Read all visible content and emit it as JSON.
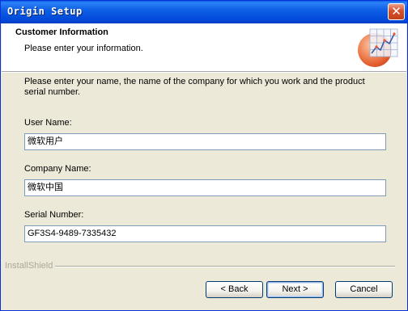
{
  "window": {
    "title": "Origin Setup",
    "close_glyph": "✕"
  },
  "header": {
    "title": "Customer Information",
    "subtitle": "Please enter your information.",
    "logo_icon": "origin-graph-logo-icon"
  },
  "body": {
    "description": "Please enter your name, the name of the company for which you work and the product serial number.",
    "user_name": {
      "label": "User Name:",
      "value": "微软用户"
    },
    "company_name": {
      "label": "Company Name:",
      "value": "微软中国"
    },
    "serial_number": {
      "label": "Serial Number:",
      "value": "GF3S4-9489-7335432"
    }
  },
  "footer": {
    "brand": "InstallShield",
    "back_label": "< Back",
    "next_label": "Next >",
    "cancel_label": "Cancel"
  },
  "colors": {
    "titlebar": "#0054E3",
    "dialog_bg": "#ECE9D8",
    "field_border": "#7F9DB9",
    "logo_accent": "#E8562A"
  }
}
